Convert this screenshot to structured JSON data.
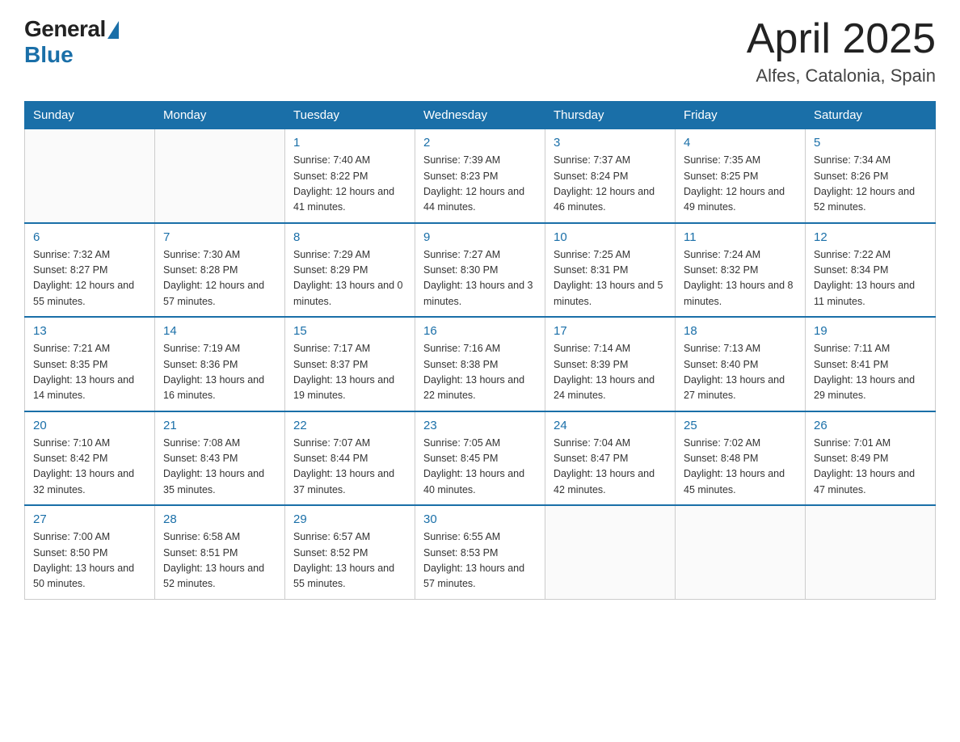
{
  "header": {
    "logo_general": "General",
    "logo_blue": "Blue",
    "title": "April 2025",
    "location": "Alfes, Catalonia, Spain"
  },
  "weekdays": [
    "Sunday",
    "Monday",
    "Tuesday",
    "Wednesday",
    "Thursday",
    "Friday",
    "Saturday"
  ],
  "weeks": [
    [
      {
        "day": "",
        "sunrise": "",
        "sunset": "",
        "daylight": ""
      },
      {
        "day": "",
        "sunrise": "",
        "sunset": "",
        "daylight": ""
      },
      {
        "day": "1",
        "sunrise": "Sunrise: 7:40 AM",
        "sunset": "Sunset: 8:22 PM",
        "daylight": "Daylight: 12 hours and 41 minutes."
      },
      {
        "day": "2",
        "sunrise": "Sunrise: 7:39 AM",
        "sunset": "Sunset: 8:23 PM",
        "daylight": "Daylight: 12 hours and 44 minutes."
      },
      {
        "day": "3",
        "sunrise": "Sunrise: 7:37 AM",
        "sunset": "Sunset: 8:24 PM",
        "daylight": "Daylight: 12 hours and 46 minutes."
      },
      {
        "day": "4",
        "sunrise": "Sunrise: 7:35 AM",
        "sunset": "Sunset: 8:25 PM",
        "daylight": "Daylight: 12 hours and 49 minutes."
      },
      {
        "day": "5",
        "sunrise": "Sunrise: 7:34 AM",
        "sunset": "Sunset: 8:26 PM",
        "daylight": "Daylight: 12 hours and 52 minutes."
      }
    ],
    [
      {
        "day": "6",
        "sunrise": "Sunrise: 7:32 AM",
        "sunset": "Sunset: 8:27 PM",
        "daylight": "Daylight: 12 hours and 55 minutes."
      },
      {
        "day": "7",
        "sunrise": "Sunrise: 7:30 AM",
        "sunset": "Sunset: 8:28 PM",
        "daylight": "Daylight: 12 hours and 57 minutes."
      },
      {
        "day": "8",
        "sunrise": "Sunrise: 7:29 AM",
        "sunset": "Sunset: 8:29 PM",
        "daylight": "Daylight: 13 hours and 0 minutes."
      },
      {
        "day": "9",
        "sunrise": "Sunrise: 7:27 AM",
        "sunset": "Sunset: 8:30 PM",
        "daylight": "Daylight: 13 hours and 3 minutes."
      },
      {
        "day": "10",
        "sunrise": "Sunrise: 7:25 AM",
        "sunset": "Sunset: 8:31 PM",
        "daylight": "Daylight: 13 hours and 5 minutes."
      },
      {
        "day": "11",
        "sunrise": "Sunrise: 7:24 AM",
        "sunset": "Sunset: 8:32 PM",
        "daylight": "Daylight: 13 hours and 8 minutes."
      },
      {
        "day": "12",
        "sunrise": "Sunrise: 7:22 AM",
        "sunset": "Sunset: 8:34 PM",
        "daylight": "Daylight: 13 hours and 11 minutes."
      }
    ],
    [
      {
        "day": "13",
        "sunrise": "Sunrise: 7:21 AM",
        "sunset": "Sunset: 8:35 PM",
        "daylight": "Daylight: 13 hours and 14 minutes."
      },
      {
        "day": "14",
        "sunrise": "Sunrise: 7:19 AM",
        "sunset": "Sunset: 8:36 PM",
        "daylight": "Daylight: 13 hours and 16 minutes."
      },
      {
        "day": "15",
        "sunrise": "Sunrise: 7:17 AM",
        "sunset": "Sunset: 8:37 PM",
        "daylight": "Daylight: 13 hours and 19 minutes."
      },
      {
        "day": "16",
        "sunrise": "Sunrise: 7:16 AM",
        "sunset": "Sunset: 8:38 PM",
        "daylight": "Daylight: 13 hours and 22 minutes."
      },
      {
        "day": "17",
        "sunrise": "Sunrise: 7:14 AM",
        "sunset": "Sunset: 8:39 PM",
        "daylight": "Daylight: 13 hours and 24 minutes."
      },
      {
        "day": "18",
        "sunrise": "Sunrise: 7:13 AM",
        "sunset": "Sunset: 8:40 PM",
        "daylight": "Daylight: 13 hours and 27 minutes."
      },
      {
        "day": "19",
        "sunrise": "Sunrise: 7:11 AM",
        "sunset": "Sunset: 8:41 PM",
        "daylight": "Daylight: 13 hours and 29 minutes."
      }
    ],
    [
      {
        "day": "20",
        "sunrise": "Sunrise: 7:10 AM",
        "sunset": "Sunset: 8:42 PM",
        "daylight": "Daylight: 13 hours and 32 minutes."
      },
      {
        "day": "21",
        "sunrise": "Sunrise: 7:08 AM",
        "sunset": "Sunset: 8:43 PM",
        "daylight": "Daylight: 13 hours and 35 minutes."
      },
      {
        "day": "22",
        "sunrise": "Sunrise: 7:07 AM",
        "sunset": "Sunset: 8:44 PM",
        "daylight": "Daylight: 13 hours and 37 minutes."
      },
      {
        "day": "23",
        "sunrise": "Sunrise: 7:05 AM",
        "sunset": "Sunset: 8:45 PM",
        "daylight": "Daylight: 13 hours and 40 minutes."
      },
      {
        "day": "24",
        "sunrise": "Sunrise: 7:04 AM",
        "sunset": "Sunset: 8:47 PM",
        "daylight": "Daylight: 13 hours and 42 minutes."
      },
      {
        "day": "25",
        "sunrise": "Sunrise: 7:02 AM",
        "sunset": "Sunset: 8:48 PM",
        "daylight": "Daylight: 13 hours and 45 minutes."
      },
      {
        "day": "26",
        "sunrise": "Sunrise: 7:01 AM",
        "sunset": "Sunset: 8:49 PM",
        "daylight": "Daylight: 13 hours and 47 minutes."
      }
    ],
    [
      {
        "day": "27",
        "sunrise": "Sunrise: 7:00 AM",
        "sunset": "Sunset: 8:50 PM",
        "daylight": "Daylight: 13 hours and 50 minutes."
      },
      {
        "day": "28",
        "sunrise": "Sunrise: 6:58 AM",
        "sunset": "Sunset: 8:51 PM",
        "daylight": "Daylight: 13 hours and 52 minutes."
      },
      {
        "day": "29",
        "sunrise": "Sunrise: 6:57 AM",
        "sunset": "Sunset: 8:52 PM",
        "daylight": "Daylight: 13 hours and 55 minutes."
      },
      {
        "day": "30",
        "sunrise": "Sunrise: 6:55 AM",
        "sunset": "Sunset: 8:53 PM",
        "daylight": "Daylight: 13 hours and 57 minutes."
      },
      {
        "day": "",
        "sunrise": "",
        "sunset": "",
        "daylight": ""
      },
      {
        "day": "",
        "sunrise": "",
        "sunset": "",
        "daylight": ""
      },
      {
        "day": "",
        "sunrise": "",
        "sunset": "",
        "daylight": ""
      }
    ]
  ]
}
